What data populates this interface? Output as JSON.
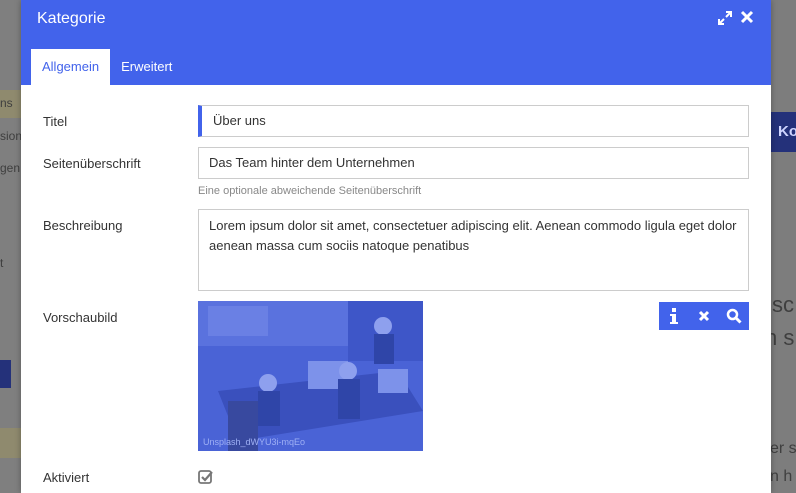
{
  "background": {
    "fragments_left": [
      "ns",
      "sion",
      "gen",
      "t"
    ],
    "fragment_right_button": "Ko",
    "fragments_right_big": [
      "sc",
      "n s"
    ],
    "fragments_right_small": [
      "er s",
      "n h"
    ]
  },
  "dialog": {
    "title": "Kategorie",
    "expand_icon": "expand-icon",
    "close_icon": "close-icon",
    "tabs": [
      {
        "label": "Allgemein",
        "active": true
      },
      {
        "label": "Erweitert",
        "active": false
      }
    ],
    "fields": {
      "titel": {
        "label": "Titel",
        "value": "Über uns"
      },
      "subtitle": {
        "label": "Seitenüberschrift",
        "value": "Das Team hinter dem Unternehmen",
        "help": "Eine optionale abweichende Seitenüberschrift"
      },
      "description": {
        "label": "Beschreibung",
        "value": "Lorem ipsum dolor sit amet, consectetuer adipiscing elit. Aenean commodo ligula eget dolor aenean massa cum sociis natoque penatibus"
      },
      "preview": {
        "label": "Vorschaubild",
        "caption": "Unsplash_dWYU3i-mqEo"
      },
      "active": {
        "label": "Aktiviert",
        "checked": true
      }
    }
  },
  "colors": {
    "accent": "#4263eb"
  }
}
